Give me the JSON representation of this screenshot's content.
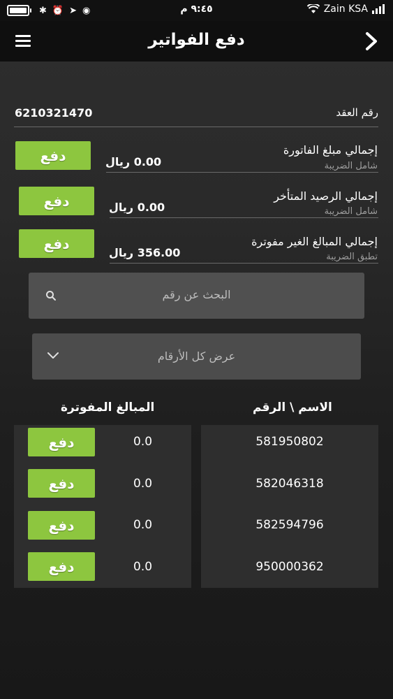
{
  "status_bar": {
    "time": "٩:٤٥ م",
    "carrier": "Zain KSA"
  },
  "nav": {
    "title": "دفع الفواتير"
  },
  "contract": {
    "label": "رقم العقد",
    "value": "6210321470"
  },
  "summary": [
    {
      "label": "إجمالي مبلغ الفاتورة",
      "sub": "شامل الضريبة",
      "amount": "0.00 ريال",
      "pay_label": "دفع"
    },
    {
      "label": "إجمالي الرصيد المتأخر",
      "sub": "شامل الضريبة",
      "amount": "0.00 ريال",
      "pay_label": "دفع"
    },
    {
      "label": "إجمالي المبالغ الغير مفوترة",
      "sub": "تطبق الضريبة",
      "amount": "356.00 ريال",
      "pay_label": "دفع"
    }
  ],
  "search": {
    "placeholder": "البحث عن رقم"
  },
  "filter": {
    "selected": "عرض كل الأرقام"
  },
  "table": {
    "headers": {
      "name_number": "الاسم \\ الرقم",
      "billed_amounts": "المبالغ المفوترة"
    },
    "rows": [
      {
        "number": "581950802",
        "amount": "0.0",
        "pay_label": "دفع"
      },
      {
        "number": "582046318",
        "amount": "0.0",
        "pay_label": "دفع"
      },
      {
        "number": "582594796",
        "amount": "0.0",
        "pay_label": "دفع"
      },
      {
        "number": "950000362",
        "amount": "0.0",
        "pay_label": "دفع"
      }
    ]
  },
  "colors": {
    "accent_green": "#8dc63f",
    "background": "#2a2a2a",
    "nav_background": "#0f0f0f"
  }
}
